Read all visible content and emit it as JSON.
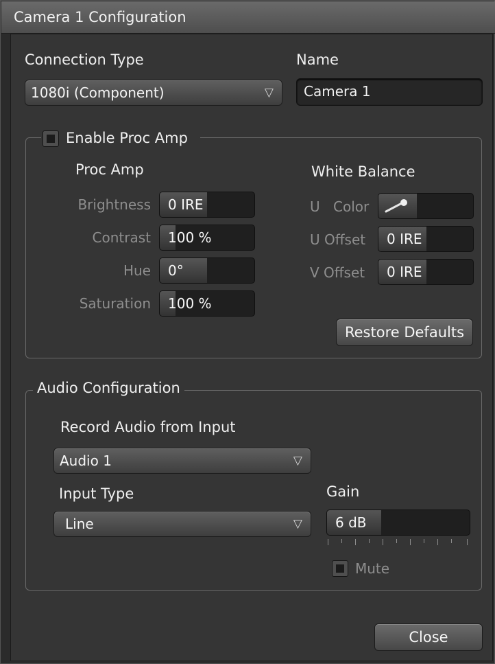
{
  "window": {
    "title": "Camera 1 Configuration"
  },
  "connection": {
    "label": "Connection Type",
    "value": "1080i (Component)"
  },
  "name": {
    "label": "Name",
    "value": "Camera 1"
  },
  "proc_amp": {
    "enable_label": "Enable Proc Amp",
    "enabled": false,
    "heading": "Proc Amp",
    "rows": [
      {
        "label": "Brightness",
        "value": "0 IRE",
        "level": 0.5
      },
      {
        "label": "Contrast",
        "value": "100 %",
        "level": 0.17
      },
      {
        "label": "Hue",
        "value": "0°",
        "level": 0.5
      },
      {
        "label": "Saturation",
        "value": "100 %",
        "level": 0.17
      }
    ]
  },
  "white_balance": {
    "heading": "White Balance",
    "u_color_prefix": "U",
    "u_color_label": "Color",
    "u_offset_label": "U Offset",
    "u_offset_value": "0 IRE",
    "v_offset_label": "V Offset",
    "v_offset_value": "0 IRE",
    "eyedropper_icon": "eyedropper-icon"
  },
  "restore_label": "Restore Defaults",
  "audio": {
    "heading": "Audio Configuration",
    "record_label": "Record Audio from Input",
    "record_value": "Audio 1",
    "input_type_label": "Input Type",
    "input_type_value": "Line",
    "gain_label": "Gain",
    "gain_value": "6 dB",
    "gain_level": 0.38,
    "mute_label": "Mute",
    "muted": false
  },
  "close_label": "Close",
  "dropdown_arrow": "▽"
}
